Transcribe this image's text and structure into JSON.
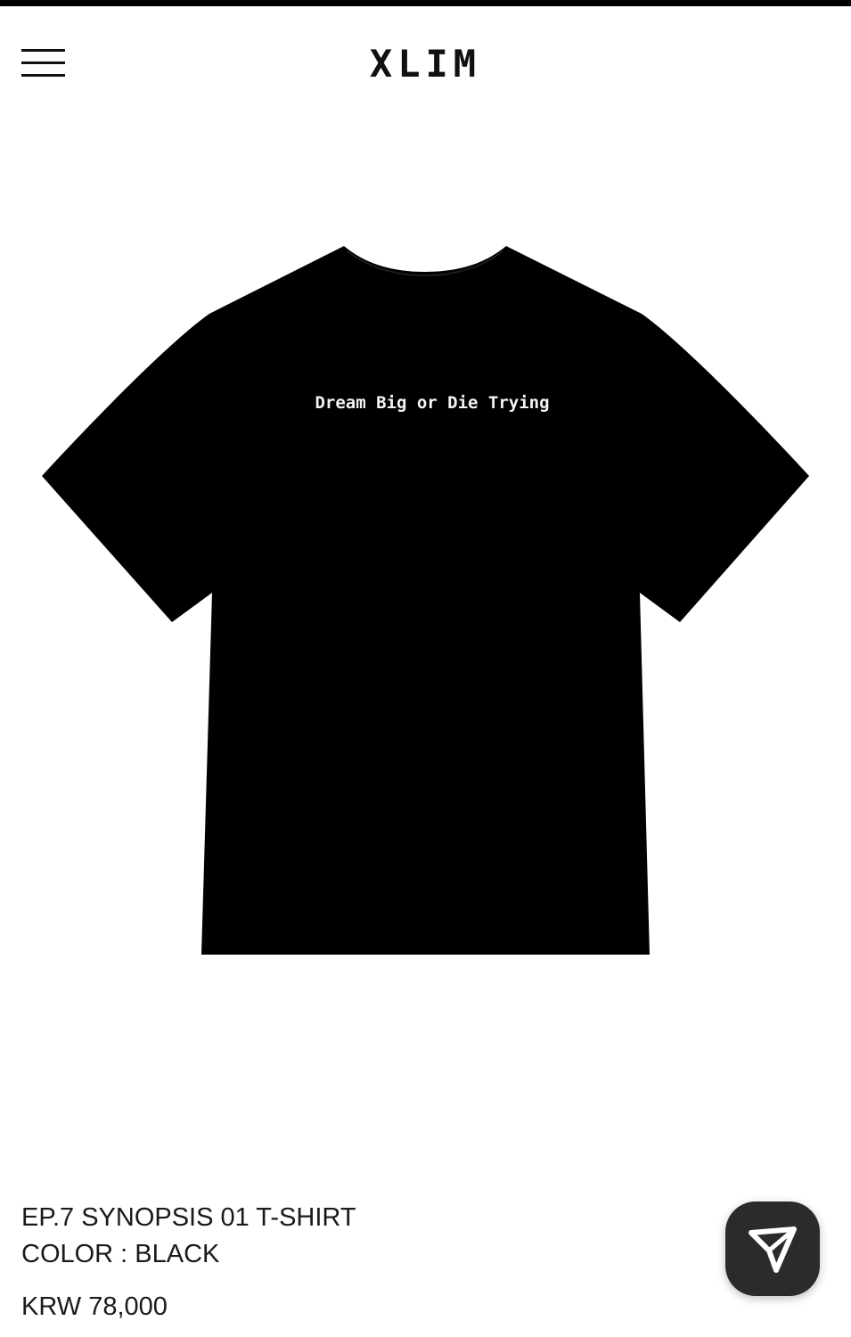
{
  "header": {
    "logo": "XLIM",
    "menu_icon": "hamburger-menu-icon"
  },
  "product": {
    "image_print_text": "Dream Big or Die Trying",
    "shirt_color": "#000000",
    "name": "EP.7 SYNOPSIS 01 T-SHIRT",
    "color_line": "COLOR : BLACK",
    "price": "KRW 78,000"
  },
  "floating_action": {
    "icon": "send-arrow-icon",
    "background": "#2b2b2b"
  }
}
